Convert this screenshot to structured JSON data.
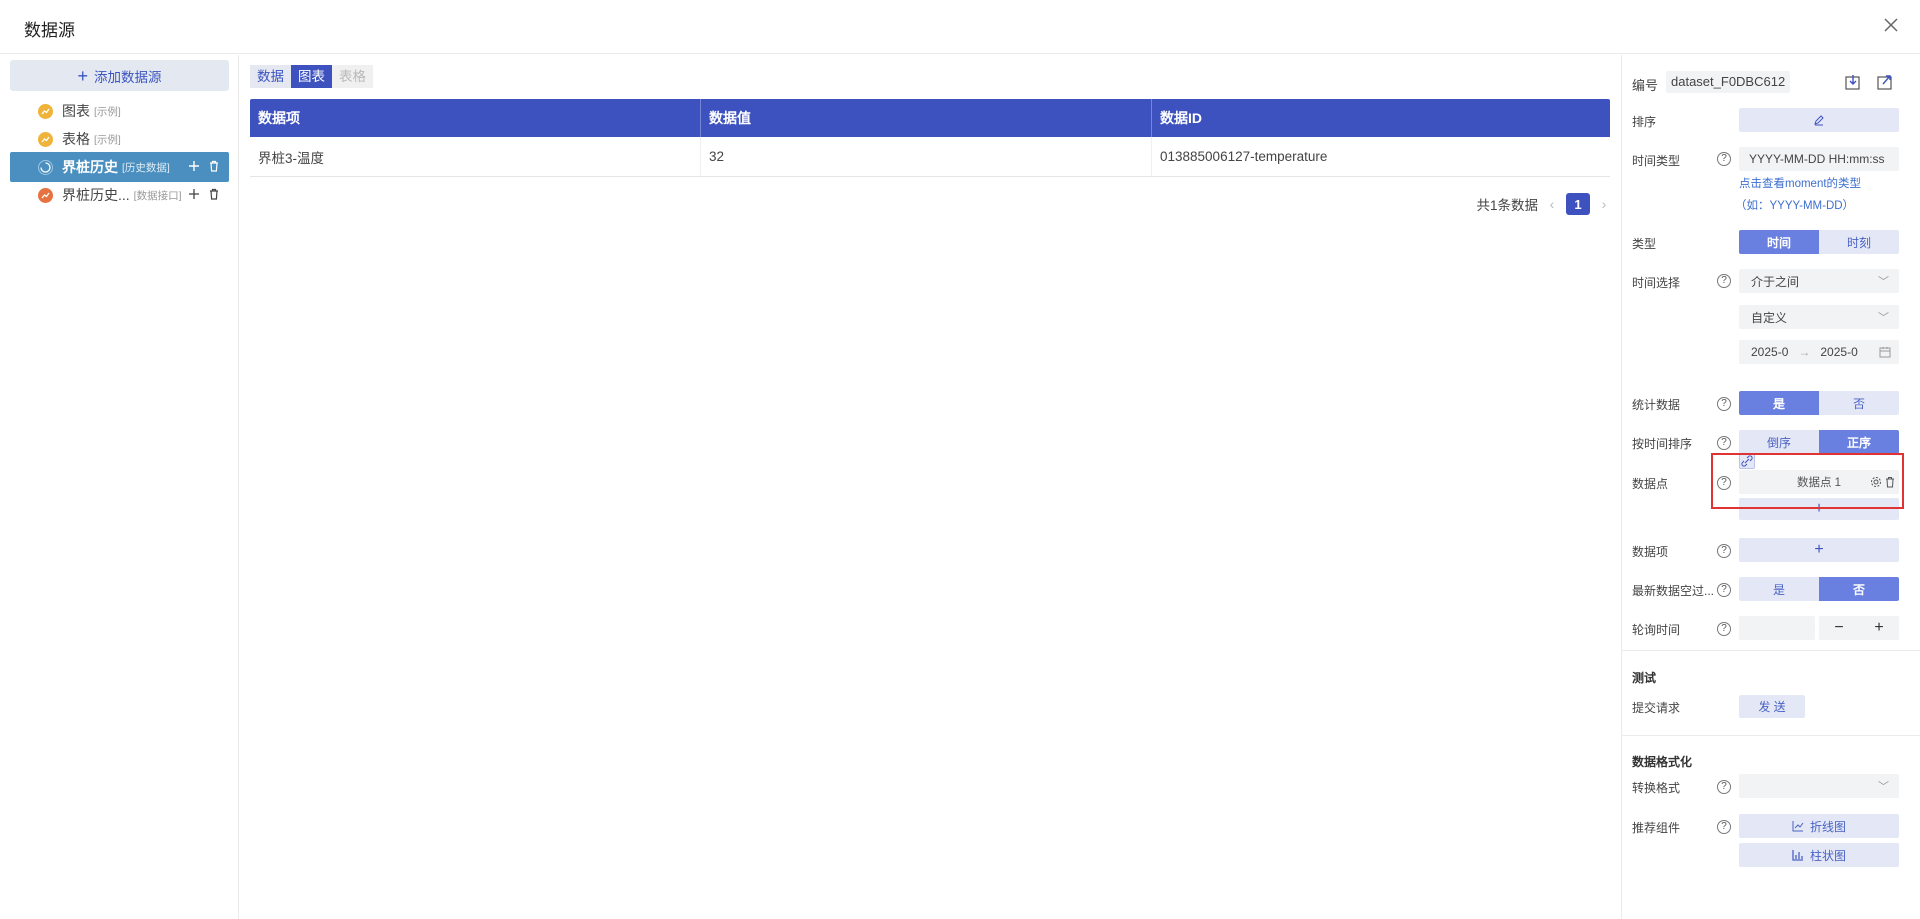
{
  "header": {
    "title": "数据源"
  },
  "sidebar": {
    "add_label": "添加数据源",
    "items": [
      {
        "label": "图表",
        "tag": "[示例]",
        "icon_color": "#f0b33a"
      },
      {
        "label": "表格",
        "tag": "[示例]",
        "icon_color": "#f0b33a"
      },
      {
        "label": "界桩历史",
        "tag": "[历史数据]",
        "icon_color": "#4a8fbf"
      },
      {
        "label": "界桩历史...",
        "tag": "[数据接口]",
        "icon_color": "#e7713f"
      }
    ]
  },
  "tabs": [
    {
      "label": "数据"
    },
    {
      "label": "图表"
    },
    {
      "label": "表格"
    }
  ],
  "table": {
    "headers": [
      "数据项",
      "数据值",
      "数据ID"
    ],
    "rows": [
      [
        "界桩3-温度",
        "32",
        "013885006127-temperature"
      ]
    ]
  },
  "pager": {
    "summary": "共1条数据",
    "current": "1"
  },
  "panel": {
    "id_label": "编号",
    "id_value": "dataset_F0DBC612",
    "sort_label": "排序",
    "time_type_label": "时间类型",
    "time_type_value": "YYYY-MM-DD HH:mm:ss",
    "moment_link": "点击查看moment的类型",
    "moment_example": "（如：YYYY-MM-DD）",
    "kind_label": "类型",
    "kind_options": [
      "时间",
      "时刻"
    ],
    "time_select_label": "时间选择",
    "time_select_value": "介于之间",
    "custom_value": "自定义",
    "date_start": "2025-0",
    "date_arrow": "→",
    "date_end": "2025-0",
    "stat_label": "统计数据",
    "yes_no": [
      "是",
      "否"
    ],
    "order_label": "按时间排序",
    "order_options": [
      "倒序",
      "正序"
    ],
    "point_label": "数据点",
    "point_item": "数据点 1",
    "item_label": "数据项",
    "latest_null_label": "最新数据空过...",
    "poll_label": "轮询时间",
    "test_title": "测试",
    "submit_label": "提交请求",
    "send_label": "发 送",
    "format_title": "数据格式化",
    "convert_label": "转换格式",
    "recommend_label": "推荐组件",
    "recommend_line": "折线图",
    "recommend_bar": "柱状图"
  },
  "colors": {
    "accent": "#3d52bf",
    "segment_on": "#6a80e0",
    "highlight": "#e03434"
  }
}
